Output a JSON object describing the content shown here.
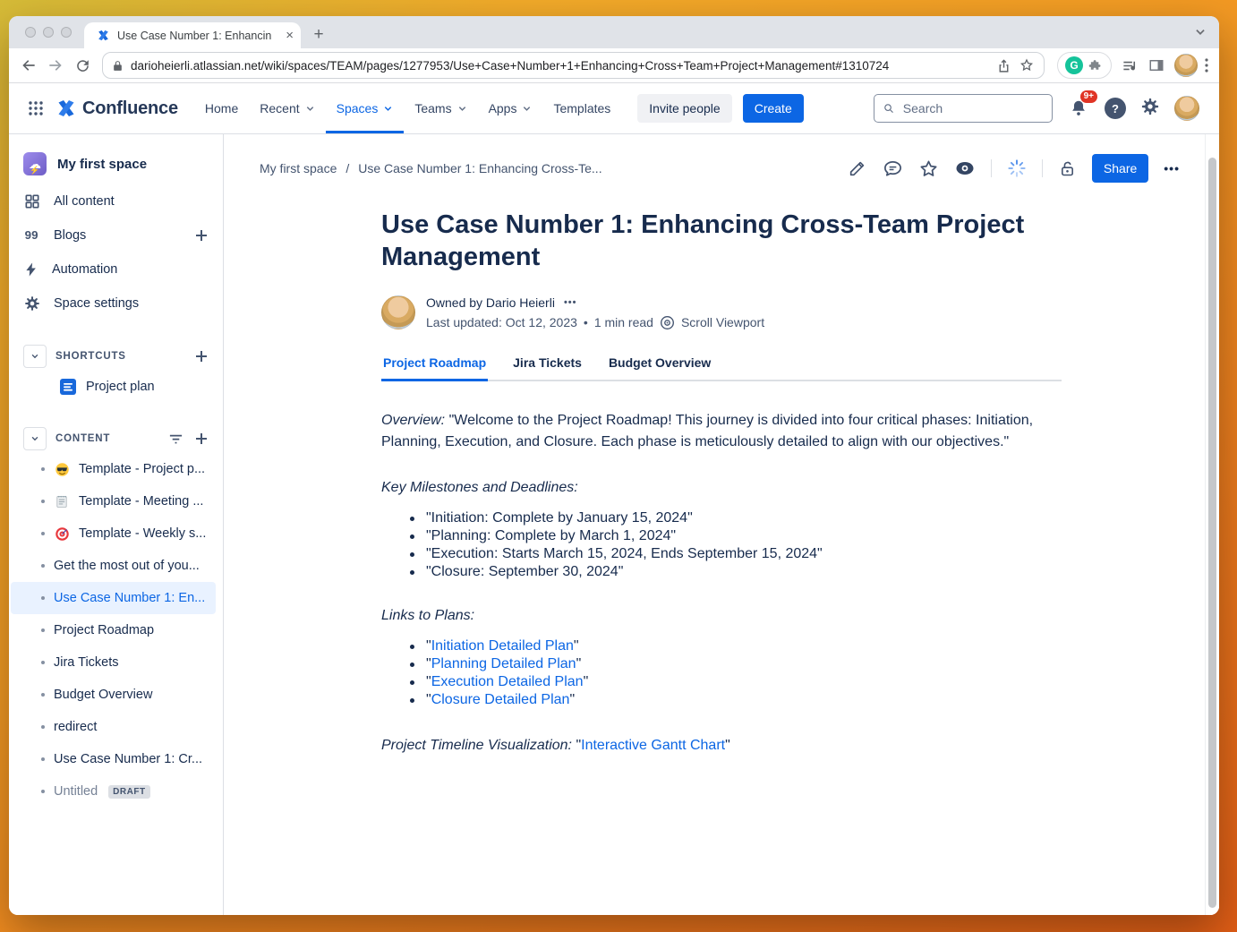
{
  "theme": {
    "accent_blue": "#0C66E4",
    "selected_item_bg": "#E9F2FF",
    "text_primary": "#172B4D",
    "text_secondary": "#44546F",
    "notification_badge_red": "#E03425",
    "grammarly_green": "#15C39A",
    "space_icon_purple": "#7E6BD9",
    "wallpaper_orange": "#EC7F1E"
  },
  "browser": {
    "tab_title": "Use Case Number 1: Enhancin",
    "tab_close": "×",
    "new_tab": "+",
    "url": "darioheierli.atlassian.net/wiki/spaces/TEAM/pages/1277953/Use+Case+Number+1+Enhancing+Cross+Team+Project+Management#1310724",
    "menu_dots": "⋮"
  },
  "nav": {
    "brand": "Confluence",
    "items": [
      {
        "label": "Home"
      },
      {
        "label": "Recent"
      },
      {
        "label": "Spaces"
      },
      {
        "label": "Teams"
      },
      {
        "label": "Apps"
      },
      {
        "label": "Templates"
      }
    ],
    "invite_label": "Invite people",
    "create_label": "Create",
    "search_placeholder": "Search",
    "notifications_badge": "9+",
    "help_glyph": "?"
  },
  "sidebar": {
    "space_name": "My first space",
    "menu": [
      {
        "label": "All content",
        "icon": "all-content-grid-icon"
      },
      {
        "label": "Blogs",
        "icon": "blogs-quote-icon"
      },
      {
        "label": "Automation",
        "icon": "lightning-icon"
      },
      {
        "label": "Space settings",
        "icon": "gear-icon"
      }
    ],
    "shortcuts_title": "SHORTCUTS",
    "shortcut_item": "Project plan",
    "content_title": "CONTENT",
    "content_items": [
      {
        "label": "Template - Project p...",
        "icon": "sunglasses-emoji-icon"
      },
      {
        "label": "Template - Meeting ...",
        "icon": "notepad-emoji-icon"
      },
      {
        "label": "Template - Weekly s...",
        "icon": "target-emoji-icon"
      },
      {
        "label": "Get the most out of you..."
      },
      {
        "label": "Use Case Number 1: En...",
        "selected": true
      },
      {
        "label": "Project Roadmap"
      },
      {
        "label": "Jira Tickets"
      },
      {
        "label": "Budget Overview"
      },
      {
        "label": "redirect"
      },
      {
        "label": "Use Case Number 1: Cr..."
      },
      {
        "label": "Untitled",
        "badge": "DRAFT"
      }
    ]
  },
  "page": {
    "breadcrumb": [
      "My first space",
      "Use Case Number 1: Enhancing Cross-Te..."
    ],
    "breadcrumb_sep": "/",
    "share_label": "Share",
    "more_dots": "•••",
    "title": "Use Case Number 1: Enhancing Cross-Team Project Management",
    "owned_by": "Owned by Dario Heierli",
    "owner_more": "•••",
    "last_updated": "Last updated: Oct 12, 2023",
    "meta_sep": "•",
    "read_time": "1 min read",
    "viewport_label": "Scroll Viewport",
    "tabs": [
      "Project Roadmap",
      "Jira Tickets",
      "Budget Overview"
    ],
    "overview_label": "Overview:",
    "overview_text": "\"Welcome to the Project Roadmap! This journey is divided into four critical phases: Initiation, Planning, Execution, and Closure. Each phase is meticulously detailed to align with our objectives.\"",
    "milestones_label": "Key Milestones and Deadlines:",
    "milestones": [
      "\"Initiation: Complete by January 15, 2024\"",
      "\"Planning: Complete by March 1, 2024\"",
      "\"Execution: Starts March 15, 2024, Ends September 15, 2024\"",
      "\"Closure: September 30, 2024\""
    ],
    "links_label": "Links to Plans:",
    "quote": "\"",
    "links": [
      "Initiation Detailed Plan",
      "Planning Detailed Plan",
      "Execution Detailed Plan",
      "Closure Detailed Plan"
    ],
    "timeline_label": "Project Timeline Visualization:",
    "timeline_link": "Interactive Gantt Chart"
  }
}
